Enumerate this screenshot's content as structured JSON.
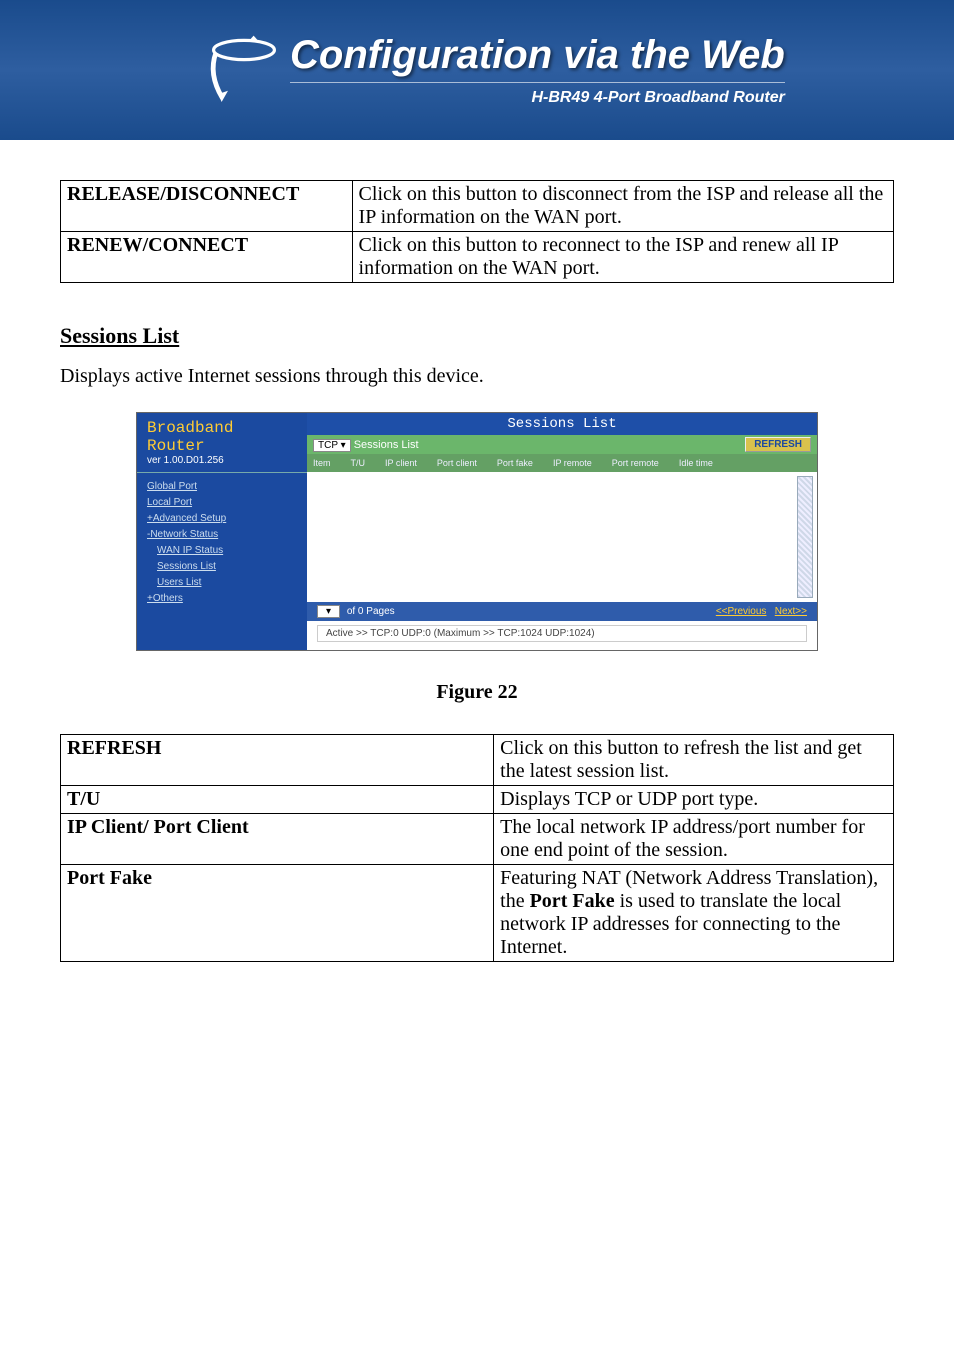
{
  "banner": {
    "title": "Configuration via the Web",
    "subtitle": "H-BR49 4-Port Broadband Router"
  },
  "tableA": {
    "rows": [
      {
        "label": "RELEASE/DISCONNECT",
        "desc": "Click on this button to disconnect from the ISP and release all the IP information on the WAN port."
      },
      {
        "label": "RENEW/CONNECT",
        "desc": "Click on this button to reconnect to the ISP and renew all IP information on the WAN port."
      }
    ]
  },
  "sessions": {
    "heading": "Sessions List",
    "body": "Displays active Internet sessions through this device."
  },
  "shot": {
    "leftTitle1": "Broadband",
    "leftTitle2": "Router",
    "ver": "ver 1.00.D01.256",
    "nav": {
      "globalPort": "Global Port",
      "localPort": "Local Port",
      "advanced": "+Advanced Setup",
      "networkStatus": "-Network Status",
      "wanIp": "WAN IP Status",
      "sessionsList": "Sessions List",
      "usersList": "Users List",
      "others": "+Others"
    },
    "rightHead": "Sessions List",
    "tcp": "TCP",
    "subLabel": "Sessions List",
    "refresh": "REFRESH",
    "cols": {
      "item": "Item",
      "tu": "T/U",
      "ipClient": "IP client",
      "portClient": "Port client",
      "portFake": "Port fake",
      "ipRemote": "IP remote",
      "portRemote": "Port remote",
      "idleTime": "Idle time"
    },
    "pagesText": "of 0 Pages",
    "prev": "<<Previous",
    "next": "Next>>",
    "footer2": "Active >> TCP:0 UDP:0   (Maximum >> TCP:1024 UDP:1024)"
  },
  "figureCaption": "Figure 22",
  "tableB": {
    "rows": [
      {
        "label": "REFRESH",
        "desc": "Click on this button to refresh the list and get the latest session list."
      },
      {
        "label": "T/U",
        "desc": "Displays TCP or UDP port type."
      },
      {
        "label": "IP Client/ Port Client",
        "desc": "The local network IP address/port number for one end point of the session."
      },
      {
        "label": "Port Fake",
        "desc_pre": "Featuring NAT (Network Address Translation), the ",
        "desc_bold": "Port Fake",
        "desc_post": " is used to translate the local network IP addresses for connecting to the Internet."
      }
    ]
  }
}
